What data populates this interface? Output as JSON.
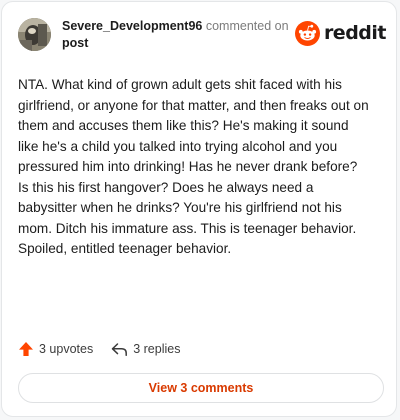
{
  "comment": {
    "username": "Severe_Development96",
    "action_text": "commented on",
    "post_link": "post",
    "brand": "reddit",
    "body": "NTA. What kind of grown adult gets shit faced with his girlfriend, or anyone for that matter, and then freaks out on them and accuses them like this? He's making it sound like he's a child you talked into trying alcohol and you pressured him into drinking! Has he never drank before? Is this his first hangover? Does he always need a babysitter when he drinks? You're his girlfriend not his mom. Ditch his immature ass. This is teenager behavior. Spoiled, entitled teenager behavior."
  },
  "stats": {
    "upvotes": "3 upvotes",
    "replies": "3 replies"
  },
  "footer": {
    "view_comments": "View 3 comments"
  },
  "icons": {
    "upvote": "upvote-arrow-icon",
    "reply": "reply-arrow-icon",
    "brand": "reddit-snoo-icon"
  },
  "colors": {
    "accent": "#d93a00",
    "upvote": "#ff4500",
    "text": "#1c1c1c",
    "muted": "#7c7c7c"
  }
}
